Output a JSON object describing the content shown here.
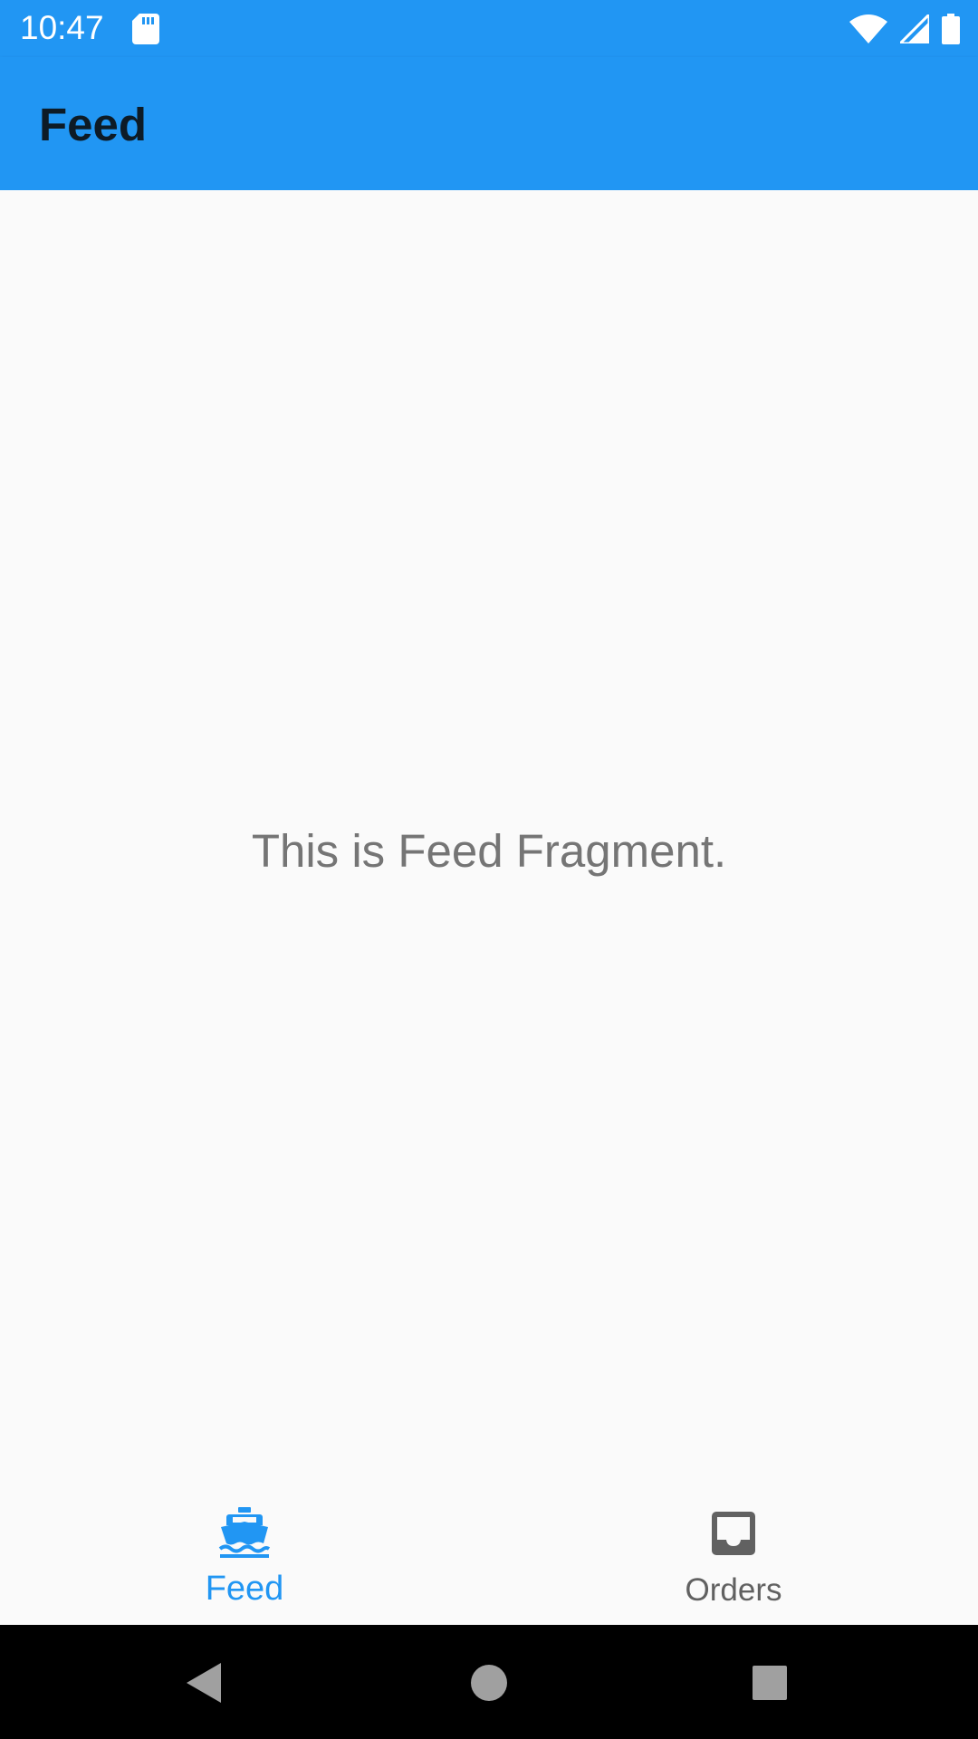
{
  "status_bar": {
    "time": "10:47",
    "icons": [
      "sd-card-icon",
      "wifi-icon",
      "signal-icon",
      "battery-icon"
    ]
  },
  "app_bar": {
    "title": "Feed"
  },
  "content": {
    "message": "This is Feed Fragment."
  },
  "bottom_nav": {
    "items": [
      {
        "label": "Feed",
        "icon": "ship-icon",
        "selected": true
      },
      {
        "label": "Orders",
        "icon": "inbox-icon",
        "selected": false
      }
    ]
  },
  "system_nav": {
    "buttons": [
      "back-icon",
      "home-icon",
      "recents-icon"
    ]
  },
  "colors": {
    "primary": "#2196f3",
    "title_text": "#0d1b26",
    "inactive": "#616161",
    "body_text": "#757575",
    "background": "#fafafa"
  }
}
